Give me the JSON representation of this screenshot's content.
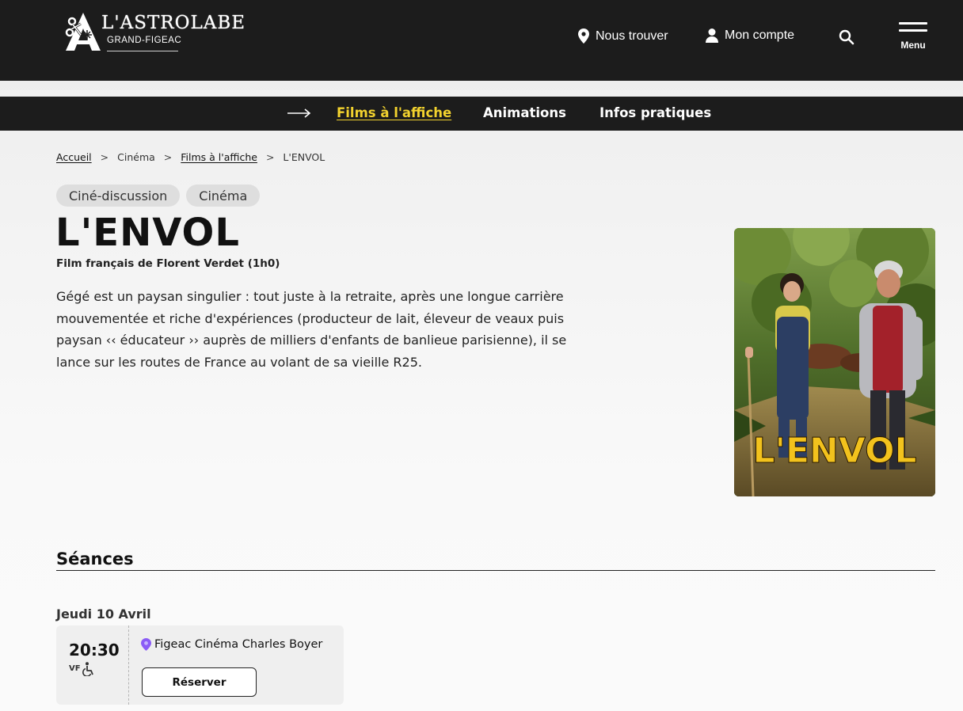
{
  "header": {
    "logo_name": "L'ASTROLABE",
    "logo_subname": "GRAND-FIGEAC",
    "find_us_label": "Nous trouver",
    "account_label": "Mon compte",
    "menu_label": "Menu"
  },
  "nav": {
    "items": [
      {
        "label": "Films à l'affiche",
        "active": true
      },
      {
        "label": "Animations",
        "active": false
      },
      {
        "label": "Infos pratiques",
        "active": false
      }
    ]
  },
  "breadcrumb": {
    "items": [
      "Accueil",
      "Cinéma",
      "Films à l'affiche",
      "L'ENVOL"
    ],
    "separator": ">"
  },
  "film": {
    "tags": [
      "Ciné-discussion",
      "Cinéma"
    ],
    "title": "L'ENVOL",
    "subtitle": "Film français de Florent Verdet (1h0)",
    "synopsis": "Gégé est un paysan singulier : tout juste à la retraite, après une longue carrière mouvementée et riche d'expériences (producteur de lait, éleveur de veaux puis paysan ‹‹ éducateur ›› auprès de milliers d'enfants de banlieue parisienne), il se lance sur les routes de France au volant de sa vieille R25.",
    "poster_title": "L'ENVOL",
    "poster_title_color": "#f2c21d"
  },
  "seances": {
    "heading": "Séances",
    "days": [
      {
        "label": "Jeudi 10 Avril",
        "sessions": [
          {
            "time": "20:30",
            "version": "VF",
            "venue": "Figeac Cinéma Charles Boyer",
            "reserve_label": "Réserver"
          }
        ]
      }
    ]
  },
  "colors": {
    "header_bg": "#1c1c1c",
    "nav_active": "#f2d22e",
    "venue_pin": "#8b5cf6"
  },
  "icons": {
    "find_us": "map-pin-icon",
    "account": "user-icon",
    "search": "search-icon",
    "menu": "hamburger-icon",
    "nav_arrow": "arrow-right-icon",
    "venue": "location-pin-icon",
    "accessibility": "wheelchair-icon"
  }
}
